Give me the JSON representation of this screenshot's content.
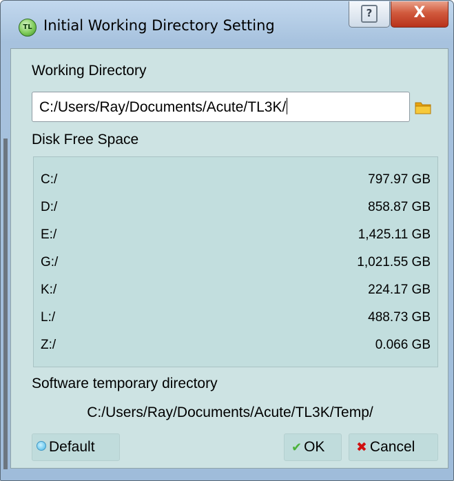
{
  "window": {
    "title": "Initial Working Directory Setting",
    "app_icon_text": "TL",
    "help_glyph": "?",
    "close_glyph": "X"
  },
  "working_directory": {
    "label": "Working Directory",
    "value": "C:/Users/Ray/Documents/Acute/TL3K/"
  },
  "disk_free_space": {
    "label": "Disk Free Space",
    "drives": [
      {
        "name": "C:/",
        "free": "797.97 GB"
      },
      {
        "name": "D:/",
        "free": "858.87 GB"
      },
      {
        "name": "E:/",
        "free": "1,425.11 GB"
      },
      {
        "name": "G:/",
        "free": "1,021.55 GB"
      },
      {
        "name": "K:/",
        "free": "224.17 GB"
      },
      {
        "name": "L:/",
        "free": "488.73 GB"
      },
      {
        "name": "Z:/",
        "free": "0.066 GB"
      }
    ]
  },
  "temp_directory": {
    "label": "Software temporary directory",
    "path": "C:/Users/Ray/Documents/Acute/TL3K/Temp/"
  },
  "buttons": {
    "default_label": "Default",
    "ok_label": "OK",
    "cancel_label": "Cancel"
  },
  "colors": {
    "client_background": "#cde3e3",
    "ok_accent": "#4bb23a",
    "cancel_accent": "#d01010",
    "close_button": "#c9442a",
    "folder_icon": "#f0b21a"
  }
}
